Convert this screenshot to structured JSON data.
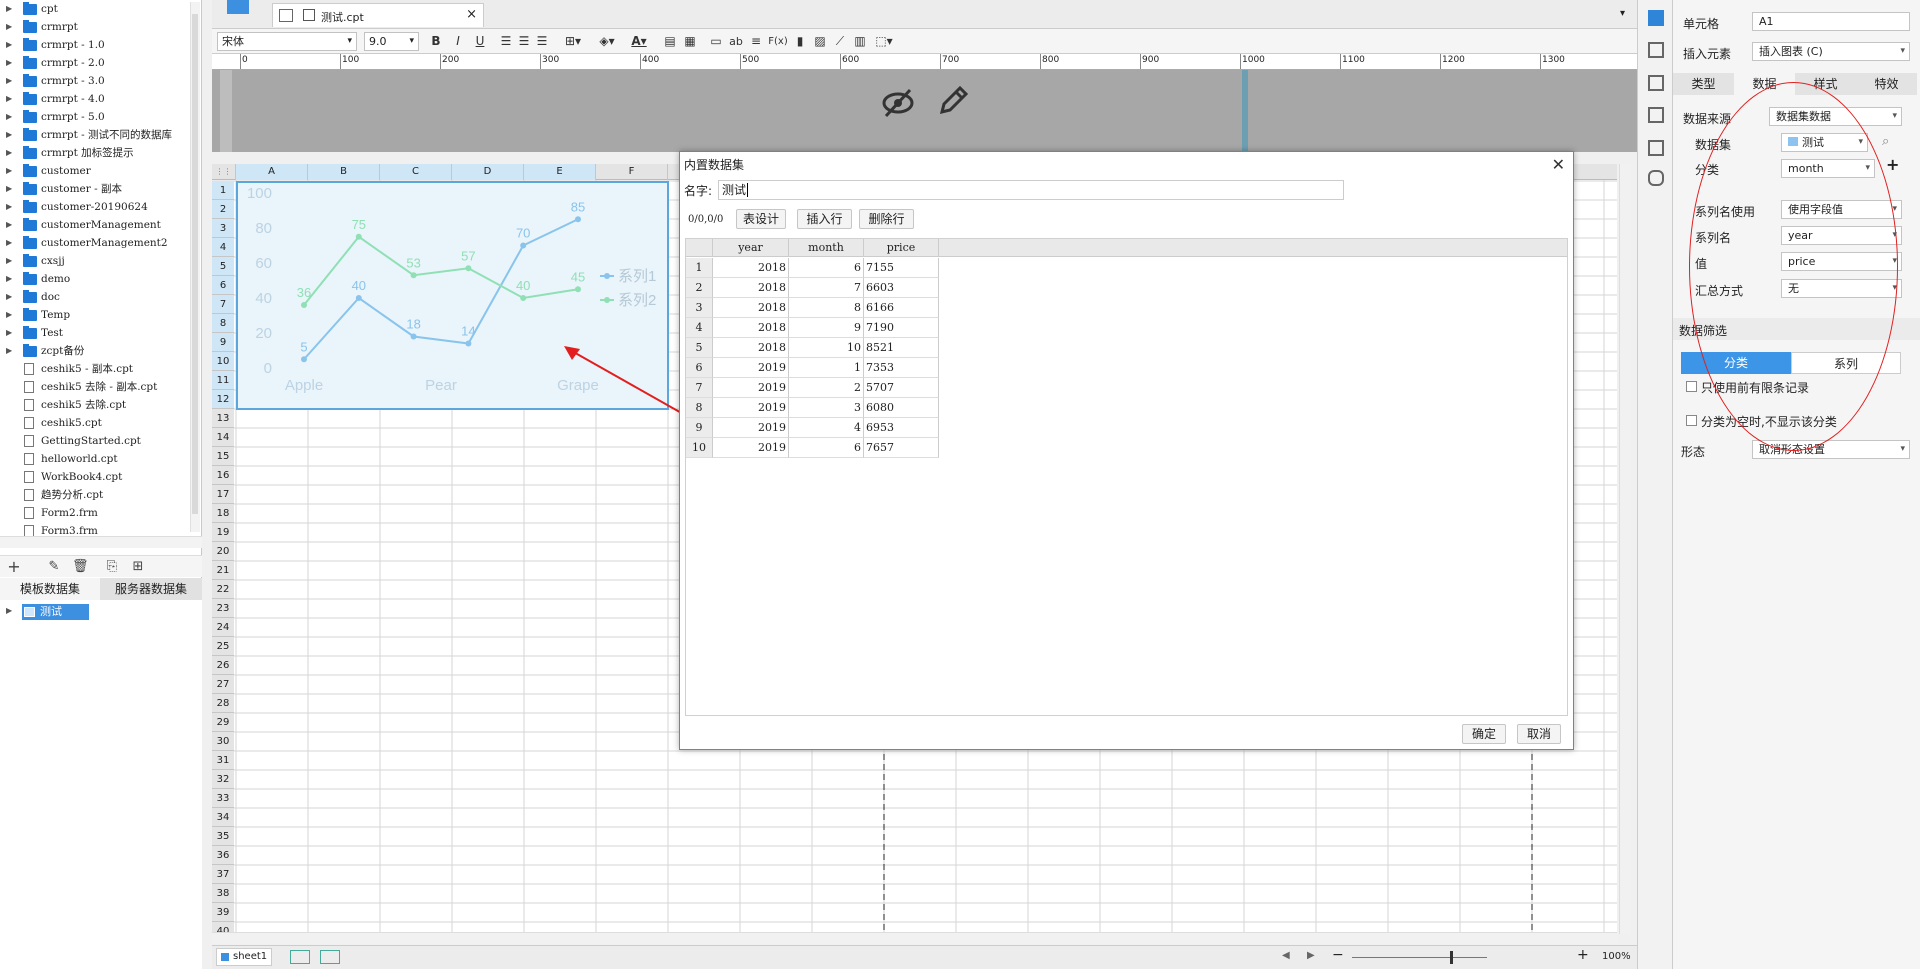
{
  "file_tree": {
    "items": [
      {
        "label": "cpt",
        "type": "folder"
      },
      {
        "label": "crmrpt",
        "type": "folder"
      },
      {
        "label": "crmrpt - 1.0",
        "type": "folder"
      },
      {
        "label": "crmrpt - 2.0",
        "type": "folder"
      },
      {
        "label": "crmrpt - 3.0",
        "type": "folder"
      },
      {
        "label": "crmrpt - 4.0",
        "type": "folder"
      },
      {
        "label": "crmrpt - 5.0",
        "type": "folder"
      },
      {
        "label": "crmrpt - 测试不同的数据库",
        "type": "folder"
      },
      {
        "label": "crmrpt 加标签提示",
        "type": "folder"
      },
      {
        "label": "customer",
        "type": "folder"
      },
      {
        "label": "customer - 副本",
        "type": "folder"
      },
      {
        "label": "customer-20190624",
        "type": "folder"
      },
      {
        "label": "customerManagement",
        "type": "folder"
      },
      {
        "label": "customerManagement2",
        "type": "folder"
      },
      {
        "label": "cxsjj",
        "type": "folder"
      },
      {
        "label": "demo",
        "type": "folder"
      },
      {
        "label": "doc",
        "type": "folder"
      },
      {
        "label": "Temp",
        "type": "folder"
      },
      {
        "label": "Test",
        "type": "folder"
      },
      {
        "label": "zcpt备份",
        "type": "folder"
      },
      {
        "label": "ceshik5 - 副本.cpt",
        "type": "file"
      },
      {
        "label": "ceshik5 去除 - 副本.cpt",
        "type": "file"
      },
      {
        "label": "ceshik5 去除.cpt",
        "type": "file"
      },
      {
        "label": "ceshik5.cpt",
        "type": "file"
      },
      {
        "label": "GettingStarted.cpt",
        "type": "file"
      },
      {
        "label": "helloworld.cpt",
        "type": "file"
      },
      {
        "label": "WorkBook4.cpt",
        "type": "file"
      },
      {
        "label": "趋势分析.cpt",
        "type": "file"
      },
      {
        "label": "Form2.frm",
        "type": "file"
      },
      {
        "label": "Form3.frm",
        "type": "file"
      }
    ]
  },
  "dataset_tabs": {
    "template": "模板数据集",
    "server": "服务器数据集"
  },
  "dataset_tree": {
    "item": "测试"
  },
  "editor_tab": {
    "label": "测试.cpt",
    "close": "×"
  },
  "toolbar": {
    "font": "宋体",
    "size": "9.0",
    "bold": "B",
    "italic": "I",
    "underline": "U",
    "text_icon": "ab",
    "formula": "F(x)"
  },
  "ruler": {
    "marks": [
      "0",
      "100",
      "200",
      "300",
      "400",
      "500",
      "600",
      "700",
      "800",
      "900",
      "1000",
      "1100",
      "1200",
      "1300"
    ]
  },
  "grid": {
    "columns": [
      "A",
      "B",
      "C",
      "D",
      "E",
      "F"
    ],
    "rows": [
      "1",
      "2",
      "3",
      "4",
      "5",
      "6",
      "7",
      "8",
      "9",
      "10",
      "11",
      "12",
      "13",
      "14",
      "15",
      "16",
      "17",
      "18",
      "19",
      "20",
      "21",
      "22",
      "23",
      "24",
      "25",
      "26",
      "27",
      "28",
      "29",
      "30",
      "31",
      "32",
      "33",
      "34",
      "35",
      "36",
      "37",
      "38",
      "39",
      "40"
    ]
  },
  "chart_data": {
    "type": "line",
    "categories": [
      "Apple",
      "Pear",
      "Grape"
    ],
    "x_ticks": [
      "Apple",
      "Pear",
      "Grape"
    ],
    "y_ticks": [
      "0",
      "20",
      "40",
      "60",
      "80",
      "100"
    ],
    "ylim": [
      0,
      100
    ],
    "series": [
      {
        "name": "系列1",
        "values": [
          5,
          40,
          18,
          14,
          70,
          85
        ],
        "color": "#89c4ec"
      },
      {
        "name": "系列2",
        "values": [
          36,
          75,
          53,
          57,
          40,
          45
        ],
        "color": "#8fe0b4"
      }
    ]
  },
  "status": {
    "sheet": "sheet1",
    "zoom": "100%"
  },
  "dialog": {
    "title": "内置数据集",
    "name_label": "名字:",
    "name_value": "测试",
    "counter": "0/0,0/0",
    "btn_design": "表设计",
    "btn_insert": "插入行",
    "btn_delete": "删除行",
    "headers": [
      "year",
      "month",
      "price"
    ],
    "rows": [
      [
        "1",
        "2018",
        "6",
        "7155"
      ],
      [
        "2",
        "2018",
        "7",
        "6603"
      ],
      [
        "3",
        "2018",
        "8",
        "6166"
      ],
      [
        "4",
        "2018",
        "9",
        "7190"
      ],
      [
        "5",
        "2018",
        "10",
        "8521"
      ],
      [
        "6",
        "2019",
        "1",
        "7353"
      ],
      [
        "7",
        "2019",
        "2",
        "5707"
      ],
      [
        "8",
        "2019",
        "3",
        "6080"
      ],
      [
        "9",
        "2019",
        "4",
        "6953"
      ],
      [
        "10",
        "2019",
        "6",
        "7657"
      ]
    ],
    "ok": "确定",
    "cancel": "取消"
  },
  "right_panel": {
    "cell_label": "单元格",
    "cell_value": "A1",
    "insert_label": "插入元素",
    "insert_value": "插入图表 (C)",
    "tabs": [
      "类型",
      "数据",
      "样式",
      "特效"
    ],
    "source_label": "数据来源",
    "source_value": "数据集数据",
    "dataset_label": "数据集",
    "dataset_value": "测试",
    "category_label": "分类",
    "category_value": "month",
    "series_use_label": "系列名使用",
    "series_use_value": "使用字段值",
    "series_name_label": "系列名",
    "series_name_value": "year",
    "value_label": "值",
    "value_value": "price",
    "agg_label": "汇总方式",
    "agg_value": "无",
    "filter_label": "数据筛选",
    "filter_tab1": "分类",
    "filter_tab2": "系列",
    "check1": "只使用前有限条记录",
    "check2": "分类为空时,不显示该分类",
    "shape_label": "形态",
    "shape_value": "取消形态设置"
  }
}
